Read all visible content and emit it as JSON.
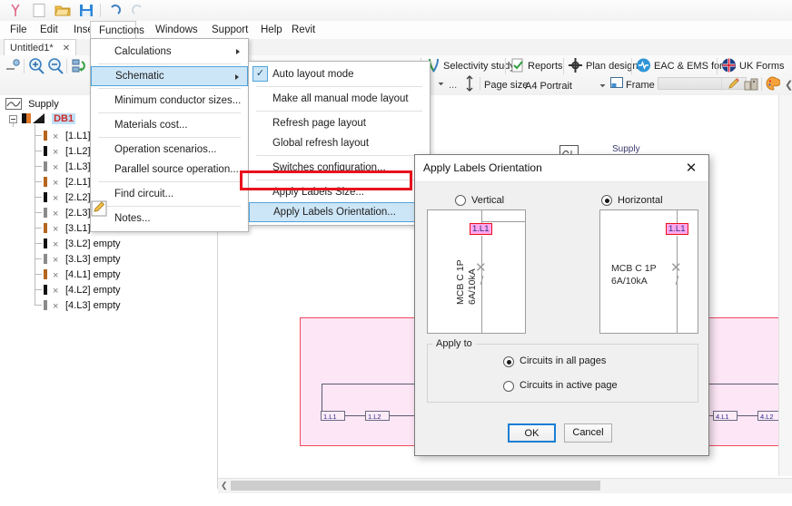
{
  "quick_access": {
    "items": [
      {
        "name": "app-logo-icon",
        "glyph": "⑂"
      },
      {
        "name": "new-file-icon",
        "glyph": "□"
      },
      {
        "name": "open-folder-icon",
        "glyph": "📂"
      },
      {
        "name": "save-icon",
        "glyph": "💾"
      },
      {
        "name": "undo-icon",
        "glyph": "↶"
      },
      {
        "name": "redo-icon",
        "glyph": "↷"
      }
    ]
  },
  "menubar": {
    "items": [
      {
        "label": "File",
        "active": false
      },
      {
        "label": "Edit",
        "active": false
      },
      {
        "label": "Insert",
        "active": false
      },
      {
        "label": "Functions",
        "active": true
      },
      {
        "label": "Windows",
        "active": false
      },
      {
        "label": "Support",
        "active": false
      },
      {
        "label": "Help",
        "active": false
      },
      {
        "label": "Revit",
        "active": false
      }
    ]
  },
  "document_tab": {
    "label": "Untitled1*",
    "close_glyph": "✕"
  },
  "ribbon": {
    "left_icons": [
      {
        "name": "fit-view-icon",
        "glyph": "⌘"
      },
      {
        "name": "zoom-in-icon",
        "glyph": "🔍"
      },
      {
        "name": "zoom-out-icon",
        "glyph": "🔍"
      },
      {
        "name": "refresh-tree-icon",
        "glyph": "↻"
      }
    ],
    "buttons": [
      {
        "label": "Selectivity study",
        "icon": "selectivity-icon"
      },
      {
        "label": "Reports",
        "icon": "reports-icon"
      },
      {
        "label": "Plan design",
        "icon": "plan-design-icon"
      },
      {
        "label": "EAC & EMS forms",
        "icon": "eac-ems-icon"
      },
      {
        "label": "UK Forms",
        "icon": "uk-flag-icon"
      }
    ],
    "row2": {
      "ellipsis": "...",
      "page_size_label": "Page size",
      "page_size_value": "A4 Portrait",
      "frame_label": "Frame",
      "right_icons": [
        {
          "name": "pencil-icon",
          "glyph": "✏"
        },
        {
          "name": "building-icon",
          "glyph": "🏢"
        },
        {
          "name": "palette-icon",
          "glyph": "🎨"
        }
      ]
    }
  },
  "tree": {
    "root": {
      "label": "Supply",
      "icon": "supply-icon"
    },
    "board": {
      "label": "DB1",
      "icon": "breaker-icon",
      "selected": true
    },
    "circuits": [
      {
        "label": "[1.L1]",
        "status": "",
        "phase_color": "#b5651d"
      },
      {
        "label": "[1.L2]",
        "status": "",
        "phase_color": "#111111"
      },
      {
        "label": "[1.L3]",
        "status": "",
        "phase_color": "#8a8a8a"
      },
      {
        "label": "[2.L1]",
        "status": "",
        "phase_color": "#b5651d"
      },
      {
        "label": "[2.L2]",
        "status": "",
        "phase_color": "#111111"
      },
      {
        "label": "[2.L3]",
        "status": "",
        "phase_color": "#8a8a8a"
      },
      {
        "label": "[3.L1]",
        "status": "",
        "phase_color": "#b5651d"
      },
      {
        "label": "[3.L2]",
        "status": "empty",
        "phase_color": "#111111"
      },
      {
        "label": "[3.L3]",
        "status": "empty",
        "phase_color": "#8a8a8a"
      },
      {
        "label": "[4.L1]",
        "status": "empty",
        "phase_color": "#b5651d"
      },
      {
        "label": "[4.L2]",
        "status": "empty",
        "phase_color": "#111111"
      },
      {
        "label": "[4.L3]",
        "status": "empty",
        "phase_color": "#8a8a8a"
      }
    ]
  },
  "menu_functions": {
    "items": [
      {
        "label": "Calculations",
        "submenu": true
      },
      {
        "label": "Schematic",
        "submenu": true,
        "highlighted": true
      },
      {
        "label": "Minimum conductor sizes...",
        "submenu": false
      },
      {
        "label": "Materials cost...",
        "submenu": false
      },
      {
        "label": "Operation scenarios...",
        "submenu": false
      },
      {
        "label": "Parallel source operation...",
        "submenu": false
      },
      {
        "label": "Find circuit...",
        "submenu": false
      },
      {
        "label": "Notes...",
        "submenu": false
      }
    ]
  },
  "menu_schematic": {
    "items": [
      {
        "label": "Auto layout mode",
        "checked": true
      },
      {
        "label": "Make all manual mode layout",
        "checked": false
      },
      {
        "label": "Refresh page layout",
        "checked": false
      },
      {
        "label": "Global refresh layout",
        "checked": false
      },
      {
        "label": "Switches configuration...",
        "checked": false
      },
      {
        "label": "Apply Labels Size...",
        "checked": false
      },
      {
        "label": "Apply Labels Orientation...",
        "checked": false,
        "highlighted": true
      }
    ],
    "check_glyph": "✓"
  },
  "canvas": {
    "supply_label": "Supply",
    "circuit_labels": [
      "1.L1",
      "1.L2",
      "4.L1",
      "4.L2"
    ]
  },
  "dialog": {
    "title": "Apply Labels Orientation",
    "close_glyph": "✕",
    "orientation": {
      "vertical": {
        "label": "Vertical",
        "selected": false
      },
      "horizontal": {
        "label": "Horizontal",
        "selected": true
      }
    },
    "preview": {
      "tag": "1.L1",
      "device_line1": "MCB C 1P",
      "device_line2": "6A/10kA"
    },
    "apply_to": {
      "caption": "Apply to",
      "options": [
        {
          "label": "Circuits in all pages",
          "selected": true
        },
        {
          "label": "Circuits in active page",
          "selected": false
        }
      ]
    },
    "ok_label": "OK",
    "cancel_label": "Cancel"
  },
  "colors": {
    "accent": "#1a7fd4",
    "highlight": "#cde6f7",
    "red_outline": "#e8121d",
    "tag_pink": "#ffa7ec",
    "page_pink": "#fde6f6"
  }
}
